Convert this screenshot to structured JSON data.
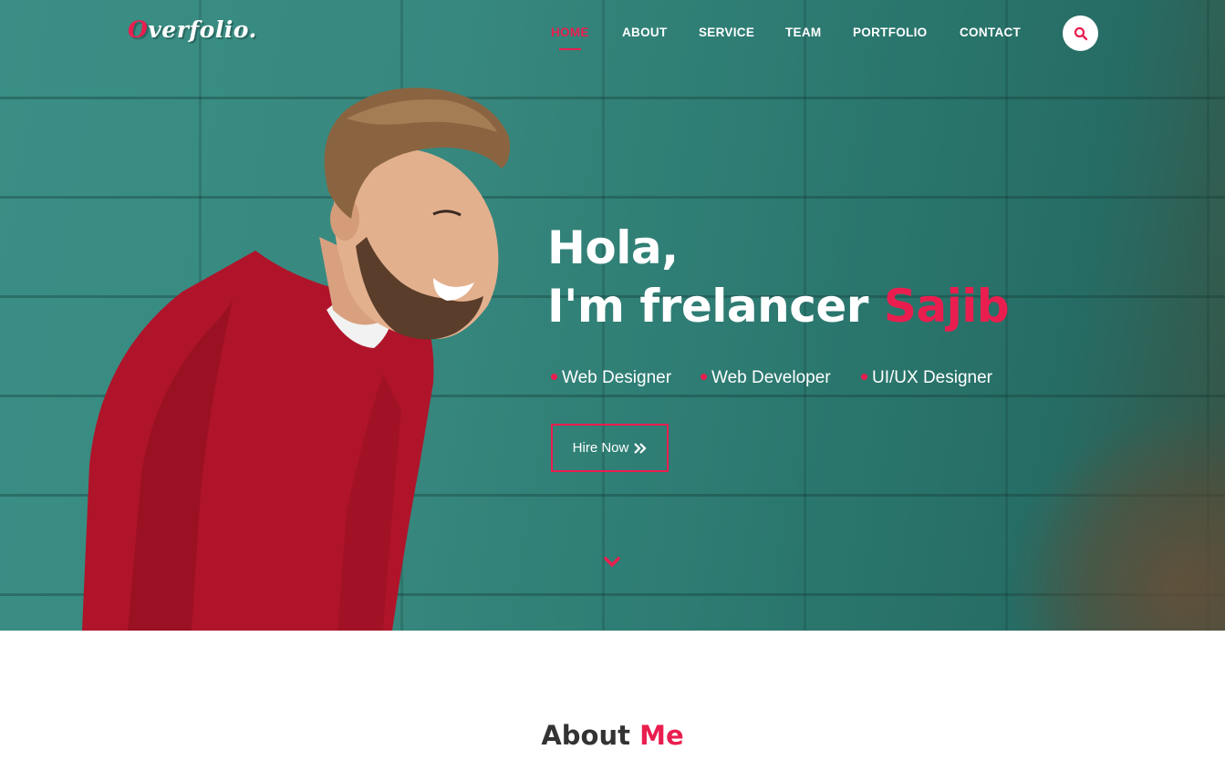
{
  "brand": {
    "logo_first": "O",
    "logo_rest": "verfolio."
  },
  "nav": {
    "items": [
      {
        "label": "HOME",
        "active": true
      },
      {
        "label": "ABOUT"
      },
      {
        "label": "SERVICE"
      },
      {
        "label": "TEAM"
      },
      {
        "label": "PORTFOLIO"
      },
      {
        "label": "CONTACT"
      }
    ],
    "search_icon": "search-icon"
  },
  "hero": {
    "greeting": "Hola,",
    "intro": "I'm frelancer",
    "name": "Sajib",
    "roles": [
      "Web Designer",
      "Web Developer",
      "UI/UX Designer"
    ],
    "cta_label": "Hire Now",
    "cta_icon": "double-chevron-right-icon",
    "scroll_icon": "chevron-down-icon"
  },
  "about": {
    "title_main": "About",
    "title_accent": "Me"
  },
  "colors": {
    "accent": "#e91e4f",
    "wall": "#3c948a",
    "heading": "#333333"
  }
}
